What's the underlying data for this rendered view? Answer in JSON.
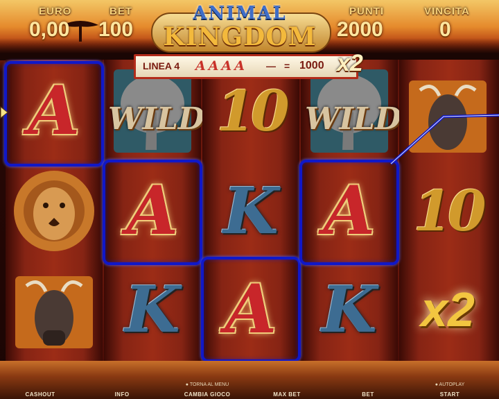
{
  "game_title": {
    "line1": "ANIMAL",
    "line2": "KINGDOM"
  },
  "hud": {
    "currency_label": "EURO",
    "credit_value": "0,00",
    "bet_label": "BET",
    "bet_value": "100",
    "points_label": "PUNTI",
    "points_value": "2000",
    "win_label": "VINCITA",
    "win_value": "0"
  },
  "win_banner": {
    "line_label": "LINEA 4",
    "symbols": "AAAA",
    "dash": "—",
    "equals": "=",
    "amount": "1000",
    "multiplier": "x2"
  },
  "reels": [
    [
      "A",
      "lion",
      "wildebeest"
    ],
    [
      "WILD",
      "A",
      "K"
    ],
    [
      "10",
      "K",
      "A"
    ],
    [
      "WILD",
      "A",
      "K"
    ],
    [
      "wildebeest",
      "10",
      "x2"
    ]
  ],
  "symbols": {
    "wild_label": "WILD",
    "ten_label": "10",
    "a_label": "A",
    "k_label": "K",
    "x2_label": "x2"
  },
  "winning_cells": [
    {
      "reel": 1,
      "row": 1
    },
    {
      "reel": 2,
      "row": 2
    },
    {
      "reel": 3,
      "row": 3
    },
    {
      "reel": 4,
      "row": 2
    }
  ],
  "bottom_bar": {
    "cashout": "CASHOUT",
    "info": "INFO",
    "menu_hint": "TORNA AL MENU",
    "change_game": "CAMBIA GIOCO",
    "max_bet": "MAX BET",
    "bet": "BET",
    "autoplay_hint": "AUTOPLAY",
    "start": "START"
  },
  "colors": {
    "payline": "#1018c8",
    "banner_border": "#b22b1a",
    "hud_text": "#ffe7a0"
  }
}
